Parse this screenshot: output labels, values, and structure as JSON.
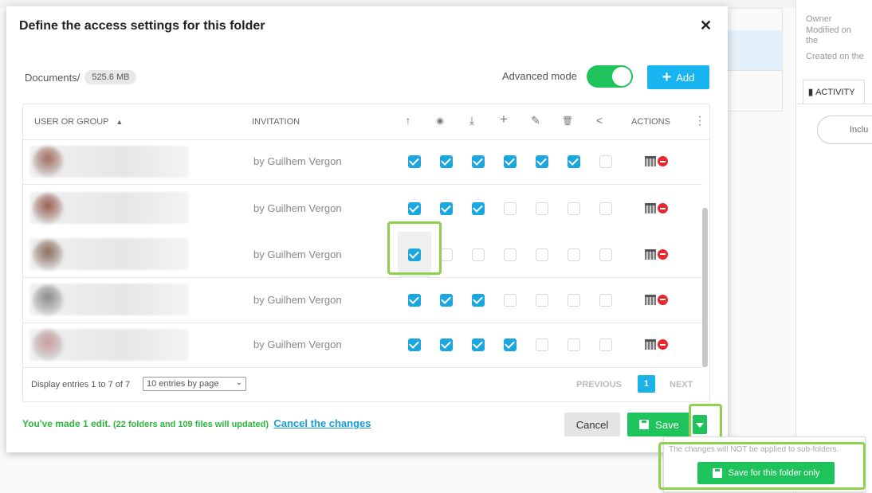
{
  "background": {
    "right_meta": [
      "Owner",
      "Modified on",
      "the",
      "Created on the"
    ],
    "activity_tab": "ACTIVITY",
    "include_pill": "Inclu"
  },
  "modal": {
    "title": "Define the access settings for this folder",
    "path_label": "Documents/",
    "size": "525.6 MB",
    "advanced_mode_label": "Advanced mode",
    "advanced_mode_on": true,
    "add_label": "Add"
  },
  "table": {
    "headers": {
      "user": "USER OR GROUP",
      "invitation": "INVITATION",
      "actions": "ACTIONS"
    },
    "permission_icons": [
      "upload-icon",
      "view-icon",
      "download-icon",
      "create-icon",
      "edit-icon",
      "delete-icon",
      "share-icon"
    ],
    "rows": [
      {
        "invitation": "by Guilhem Vergon",
        "perms": [
          true,
          true,
          true,
          true,
          true,
          true,
          false
        ]
      },
      {
        "invitation": "by Guilhem Vergon",
        "perms": [
          true,
          true,
          true,
          false,
          false,
          false,
          false
        ]
      },
      {
        "invitation": "by Guilhem Vergon",
        "perms": [
          true,
          false,
          false,
          false,
          false,
          false,
          false
        ]
      },
      {
        "invitation": "by Guilhem Vergon",
        "perms": [
          true,
          true,
          true,
          false,
          false,
          false,
          false
        ]
      },
      {
        "invitation": "by Guilhem Vergon",
        "perms": [
          true,
          true,
          true,
          true,
          false,
          false,
          false
        ]
      }
    ],
    "entries_text": "Display entries 1 to 7 of 7",
    "per_page": "10 entries by page",
    "prev": "PREVIOUS",
    "page": "1",
    "next": "NEXT"
  },
  "footer": {
    "edit_msg": "You've made 1 edit.",
    "edit_detail": "(22 folders and 109 files will updated)",
    "cancel_changes": "Cancel the changes",
    "cancel": "Cancel",
    "save": "Save"
  },
  "popover": {
    "note": "The changes will NOT be applied to sub-folders.",
    "save_folder_only": "Save for this folder only"
  },
  "colors": {
    "accent_blue": "#1aa7e0",
    "save_green": "#1ec45b",
    "highlight_green": "#8fd14f",
    "remove_red": "#e8262d"
  }
}
